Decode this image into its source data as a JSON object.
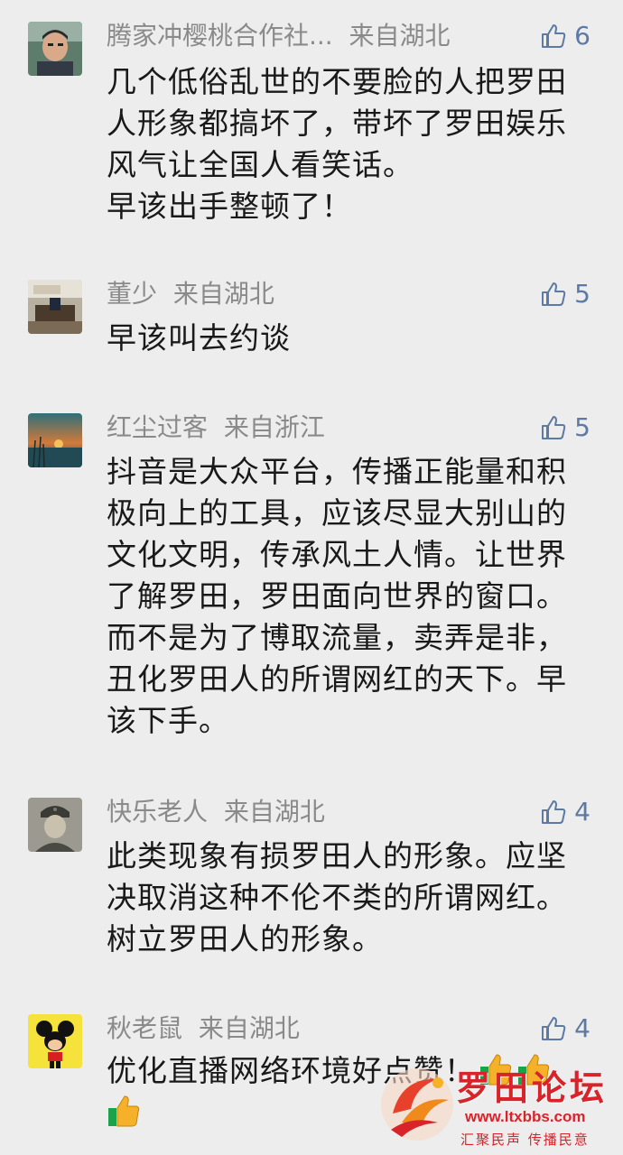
{
  "comments": [
    {
      "user": "腾家冲樱桃合作社...",
      "location": "来自湖北",
      "likes": "6",
      "lines": [
        "几个低俗乱世的不要脸的人把罗田",
        "人形象都搞坏了，带坏了罗田娱乐",
        "风气让全国人看笑话。",
        "早该出手整顿了！"
      ],
      "avatar_icon": "person-photo-avatar"
    },
    {
      "user": "董少",
      "location": "来自湖北",
      "likes": "5",
      "lines": [
        "早该叫去约谈"
      ],
      "avatar_icon": "room-photo-avatar"
    },
    {
      "user": "红尘过客",
      "location": "来自浙江",
      "likes": "5",
      "lines": [
        "抖音是大众平台，传播正能量和积",
        "极向上的工具，应该尽显大别山的",
        "文化文明，传承风土人情。让世界",
        "了解罗田，罗田面向世界的窗口。",
        "而不是为了博取流量，卖弄是非，",
        "丑化罗田人的所谓网红的天下。早",
        "该下手。"
      ],
      "avatar_icon": "sunset-photo-avatar"
    },
    {
      "user": "快乐老人",
      "location": "来自湖北",
      "likes": "4",
      "lines": [
        "此类现象有损罗田人的形象。应坚",
        "决取消这种不伦不类的所谓网红。",
        "树立罗田人的形象。"
      ],
      "avatar_icon": "soldier-photo-avatar"
    },
    {
      "user": "秋老鼠",
      "location": "来自湖北",
      "likes": "4",
      "lines": [
        "优化直播网络环境好点赞！"
      ],
      "avatar_icon": "cartoon-mouse-avatar"
    }
  ],
  "watermark": {
    "title": "罗田论坛",
    "url": "www.ltxbbs.com",
    "slogan": "汇聚民声 传播民意"
  },
  "colors": {
    "background": "#ededed",
    "name": "#8a8a8a",
    "like": "#5c7aa3",
    "text": "#191919",
    "watermark": "#d8232a"
  }
}
